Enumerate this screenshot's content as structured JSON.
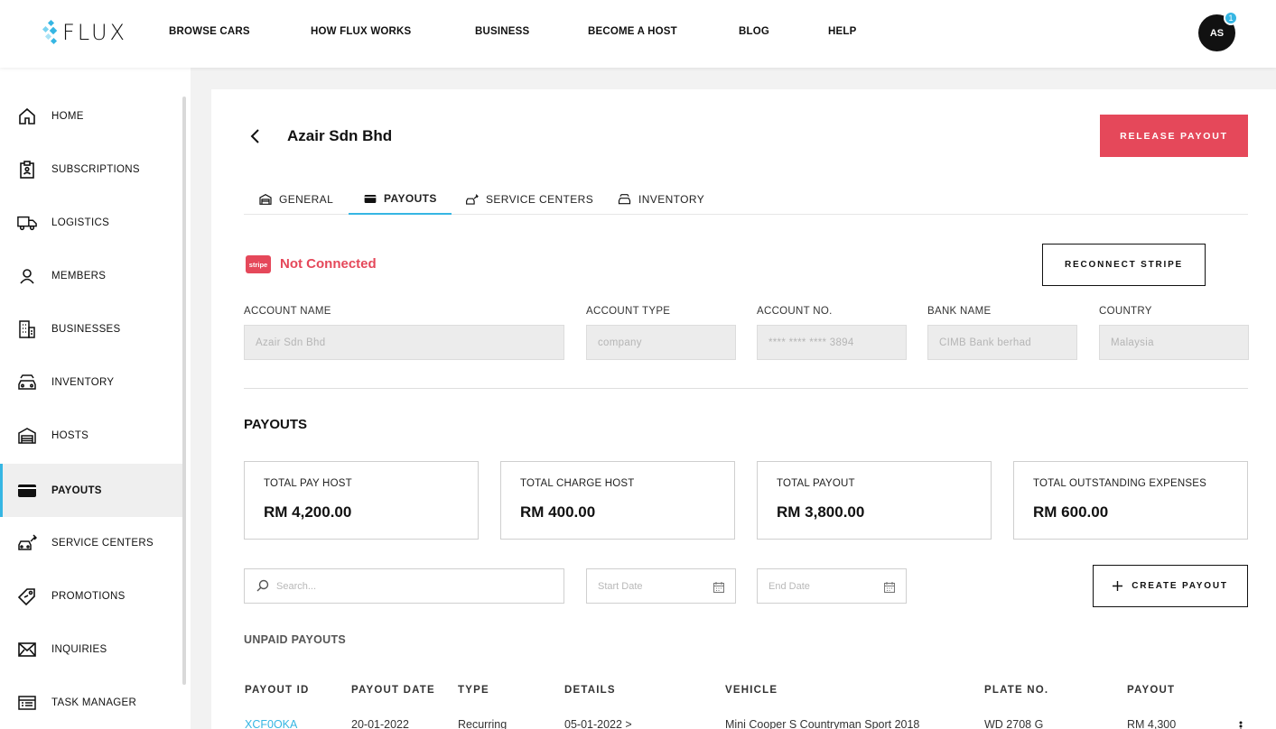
{
  "brand": {
    "name": "FLUX",
    "accent": "#36b6e3",
    "danger": "#e5485a"
  },
  "topnav": {
    "items": [
      "BROWSE CARS",
      "HOW FLUX WORKS",
      "BUSINESS",
      "BECOME A HOST",
      "BLOG",
      "HELP"
    ],
    "avatar_initials": "AS",
    "notification_count": "1"
  },
  "sidebar": {
    "items": [
      {
        "label": "HOME",
        "icon": "home-icon"
      },
      {
        "label": "SUBSCRIPTIONS",
        "icon": "clipboard-icon"
      },
      {
        "label": "LOGISTICS",
        "icon": "truck-icon"
      },
      {
        "label": "MEMBERS",
        "icon": "user-icon"
      },
      {
        "label": "BUSINESSES",
        "icon": "building-icon"
      },
      {
        "label": "INVENTORY",
        "icon": "car-stack-icon"
      },
      {
        "label": "HOSTS",
        "icon": "garage-icon"
      },
      {
        "label": "PAYOUTS",
        "icon": "card-icon",
        "active": true
      },
      {
        "label": "SERVICE CENTERS",
        "icon": "service-icon"
      },
      {
        "label": "PROMOTIONS",
        "icon": "tag-icon"
      },
      {
        "label": "INQUIRIES",
        "icon": "mail-icon"
      },
      {
        "label": "TASK MANAGER",
        "icon": "task-icon"
      }
    ]
  },
  "page": {
    "title": "Azair Sdn Bhd",
    "release_label": "RELEASE PAYOUT",
    "tabs": [
      {
        "label": "GENERAL",
        "icon": "garage-icon"
      },
      {
        "label": "PAYOUTS",
        "icon": "card-icon",
        "active": true
      },
      {
        "label": "SERVICE CENTERS",
        "icon": "service-icon"
      },
      {
        "label": "INVENTORY",
        "icon": "car-stack-icon"
      }
    ]
  },
  "stripe": {
    "logo_text": "stripe",
    "status": "Not Connected",
    "reconnect_label": "RECONNECT STRIPE"
  },
  "account": {
    "fields": [
      {
        "label": "ACCOUNT NAME",
        "value": "Azair Sdn Bhd"
      },
      {
        "label": "ACCOUNT TYPE",
        "value": "company"
      },
      {
        "label": "ACCOUNT NO.",
        "value": "**** **** **** 3894"
      },
      {
        "label": "BANK NAME",
        "value": "CIMB Bank berhad"
      },
      {
        "label": "COUNTRY",
        "value": "Malaysia"
      }
    ]
  },
  "payouts": {
    "title": "PAYOUTS",
    "stats": [
      {
        "label": "TOTAL PAY HOST",
        "value": "RM 4,200.00"
      },
      {
        "label": "TOTAL CHARGE HOST",
        "value": "RM 400.00"
      },
      {
        "label": "TOTAL PAYOUT",
        "value": "RM 3,800.00"
      },
      {
        "label": "TOTAL OUTSTANDING EXPENSES",
        "value": "RM 600.00"
      }
    ],
    "search_placeholder": "Search...",
    "start_date_placeholder": "Start Date",
    "end_date_placeholder": "End Date",
    "create_label": "CREATE PAYOUT",
    "unpaid_title": "UNPAID PAYOUTS",
    "columns": [
      "PAYOUT ID",
      "PAYOUT DATE",
      "TYPE",
      "DETAILS",
      "VEHICLE",
      "PLATE NO.",
      "PAYOUT"
    ],
    "rows": [
      [
        "XCF0OKA",
        "20-01-2022",
        "Recurring",
        "05-01-2022 >",
        "Mini Cooper S Countryman Sport 2018",
        "WD 2708 G",
        "RM 4,300"
      ]
    ]
  }
}
